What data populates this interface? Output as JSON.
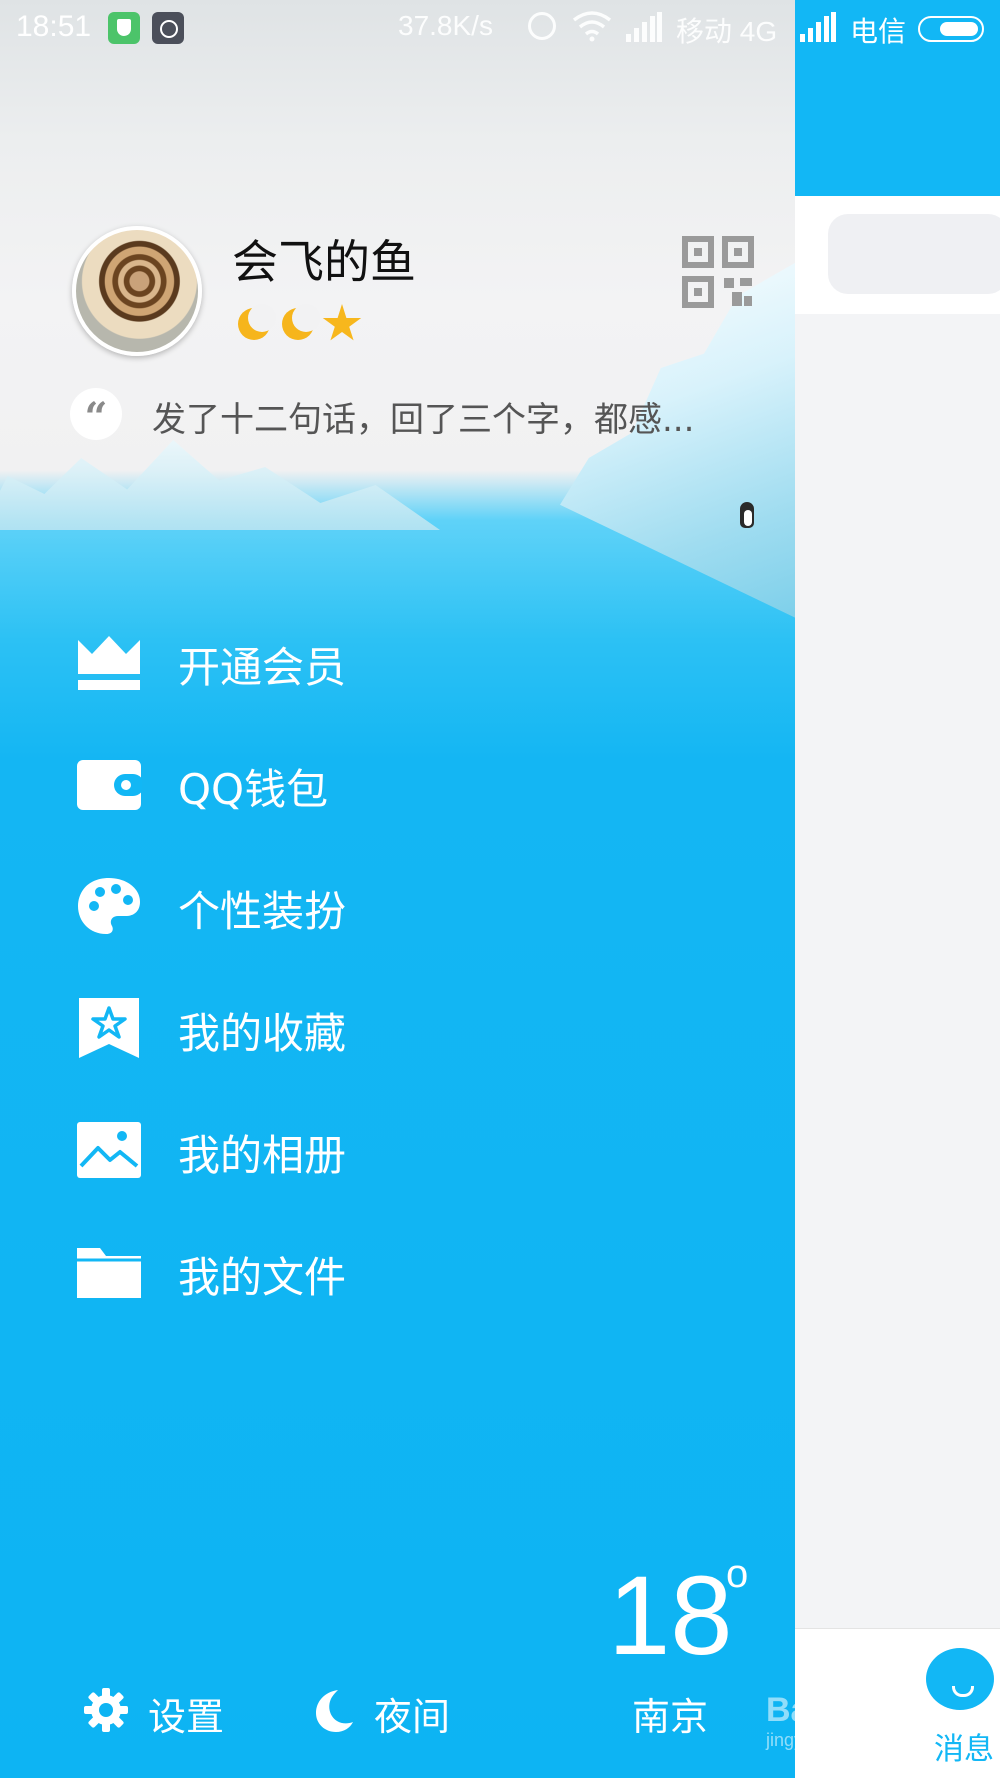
{
  "status_bar": {
    "time": "18:51",
    "speed": "37.8K/s",
    "carrier1": "移动 4G",
    "carrier2": "电信"
  },
  "profile": {
    "nickname": "会飞的鱼",
    "signature": "发了十二句话，回了三个字，都感...",
    "quote_mark": "“",
    "level_badges": [
      "moon-icon",
      "moon-icon",
      "star-icon"
    ]
  },
  "menu": {
    "items": [
      {
        "label": "开通会员",
        "icon": "crown-icon"
      },
      {
        "label": "QQ钱包",
        "icon": "wallet-icon"
      },
      {
        "label": "个性装扮",
        "icon": "palette-icon"
      },
      {
        "label": "我的收藏",
        "icon": "bookmark-star-icon"
      },
      {
        "label": "我的相册",
        "icon": "picture-icon"
      },
      {
        "label": "我的文件",
        "icon": "folder-icon"
      }
    ]
  },
  "bottom": {
    "settings_label": "设置",
    "night_label": "夜间",
    "temperature": "18",
    "degree": "o",
    "city": "南京"
  },
  "background_app": {
    "tab_message_label": "消息"
  },
  "watermark": {
    "text": "Baidu经验",
    "sub": "jingyan.baidu.com"
  },
  "colors": {
    "accent": "#12b7f5",
    "drawer_blue": "#0db4f3"
  }
}
